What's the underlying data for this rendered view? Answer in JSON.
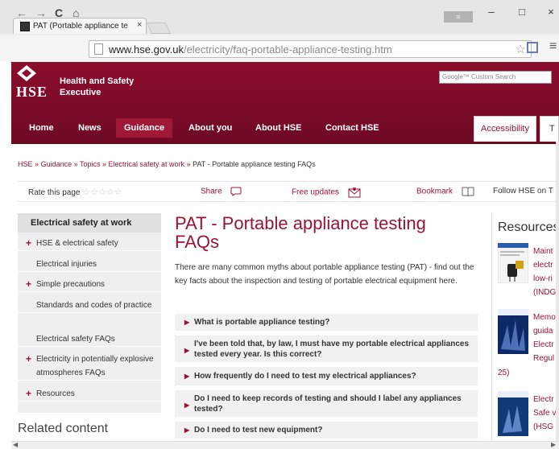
{
  "browser": {
    "tab_title": "PAT (Portable appliance te",
    "tab_close": "×",
    "user_badge": "≡",
    "win_minimize": "–",
    "win_maximize": "□",
    "win_close": "×",
    "url_host": "www.hse.gov.uk",
    "url_path": "/electricity/faq-portable-appliance-testing.htm"
  },
  "header": {
    "logo": "HSE",
    "org_name_line1": "Health and Safety",
    "org_name_line2": "Executive",
    "search_placeholder": "Google™ Custom Search"
  },
  "nav": {
    "items": [
      "Home",
      "News",
      "Guidance",
      "About you",
      "About HSE",
      "Contact HSE"
    ],
    "active": "Guidance",
    "accessibility": "Accessibility",
    "extra_tab": "T"
  },
  "breadcrumb": {
    "items": [
      "HSE",
      "Guidance",
      "Topics",
      "Electrical safety at work"
    ],
    "separator": "»",
    "current": "PAT - Portable appliance testing FAQs"
  },
  "toolbar": {
    "rate_label": "Rate this page",
    "stars": "☆☆☆☆☆",
    "share": "Share",
    "free_updates": "Free updates",
    "bookmark": "Bookmark",
    "follow": "Follow HSE on T"
  },
  "sidebar": {
    "heading": "Electrical safety at work",
    "items": [
      {
        "label": "HSE & electrical safety",
        "plus": "+"
      },
      {
        "label": "Electrical injuries",
        "plus": ""
      },
      {
        "label": "Simple precautions",
        "plus": "+"
      },
      {
        "label": "Standards and codes of practice",
        "plus": ""
      },
      {
        "label": "Electrical safety FAQs",
        "plus": ""
      },
      {
        "label": "Electricity in potentially explosive atmospheres FAQs",
        "plus": "+"
      },
      {
        "label": "Resources",
        "plus": "+"
      }
    ],
    "related": "Related content"
  },
  "main": {
    "title": "PAT - Portable appliance testing FAQs",
    "intro": "There are many common myths about portable appliance testing (PAT) - find out the key facts about the inspection and testing of portable electrical equipment here.",
    "faqs": [
      "What is portable appliance testing?",
      "I've been told that, by law, I must have my portable electrical appliances tested every year. Is this correct?",
      "How frequently do I need to test my electrical appliances?",
      "Do I need to keep records of testing and should I label any appliances tested?",
      "Do I need to test new equipment?"
    ]
  },
  "resources": {
    "title": "Resources",
    "items": [
      [
        "Maint",
        "electr",
        "low-ri",
        "(INDG"
      ],
      [
        "Memo",
        "guida",
        "Electr",
        "Regul",
        "25)"
      ],
      [
        "Electr",
        "Safe v",
        "(HSG"
      ]
    ]
  },
  "colors": {
    "brand": "#8c0d2d",
    "link": "#9c1236"
  }
}
